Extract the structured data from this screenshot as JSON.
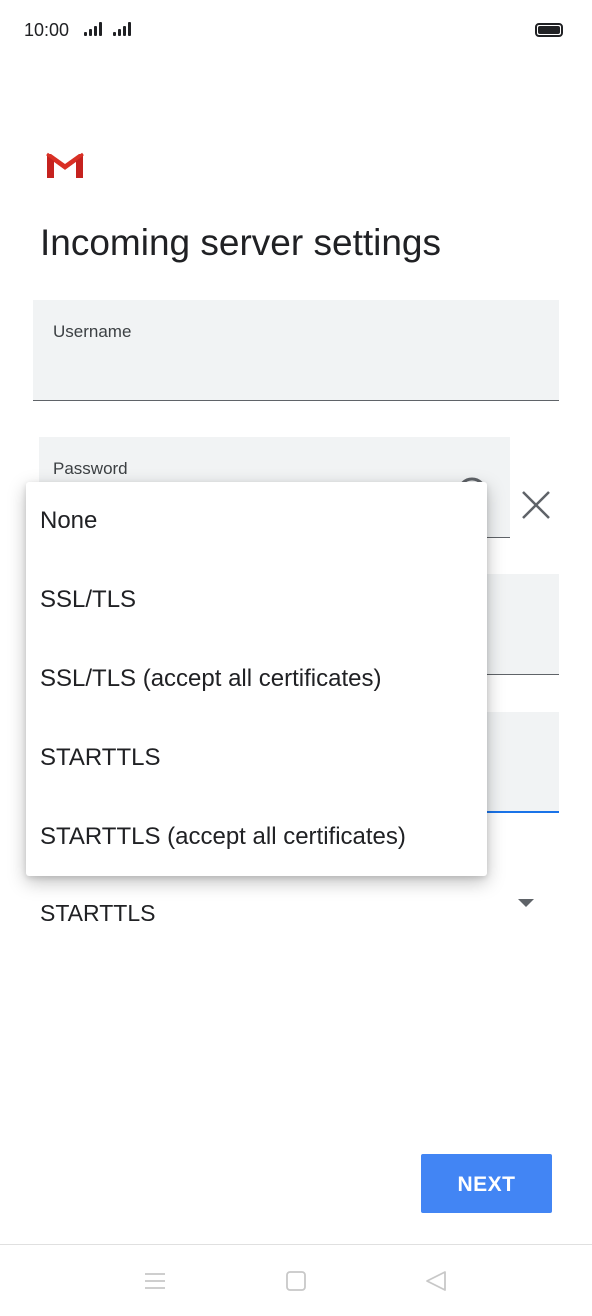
{
  "status_bar": {
    "time": "10:00",
    "signal_icon": "signal-bars-icon",
    "battery_icon": "battery-full-icon"
  },
  "app": {
    "logo_icon": "gmail-logo-icon",
    "title": "Incoming server settings"
  },
  "form": {
    "username_label": "Username",
    "password_label": "Password",
    "password_visibility_icon": "eye-icon",
    "clear_icon": "close-icon",
    "security_type_selected": "STARTTLS",
    "security_dropdown_icon": "dropdown-arrow-icon"
  },
  "dropdown": {
    "options": [
      "None",
      "SSL/TLS",
      "SSL/TLS (accept all certificates)",
      "STARTTLS",
      "STARTTLS (accept all certificates)"
    ]
  },
  "actions": {
    "next_label": "NEXT"
  },
  "nav_bar": {
    "menu_icon": "menu-icon",
    "home_icon": "home-square-icon",
    "back_icon": "back-triangle-icon"
  },
  "colors": {
    "accent": "#4285f4",
    "field_bg": "#f1f3f4",
    "focus_underline": "#1a73e8",
    "gmail_red": "#d93025"
  }
}
